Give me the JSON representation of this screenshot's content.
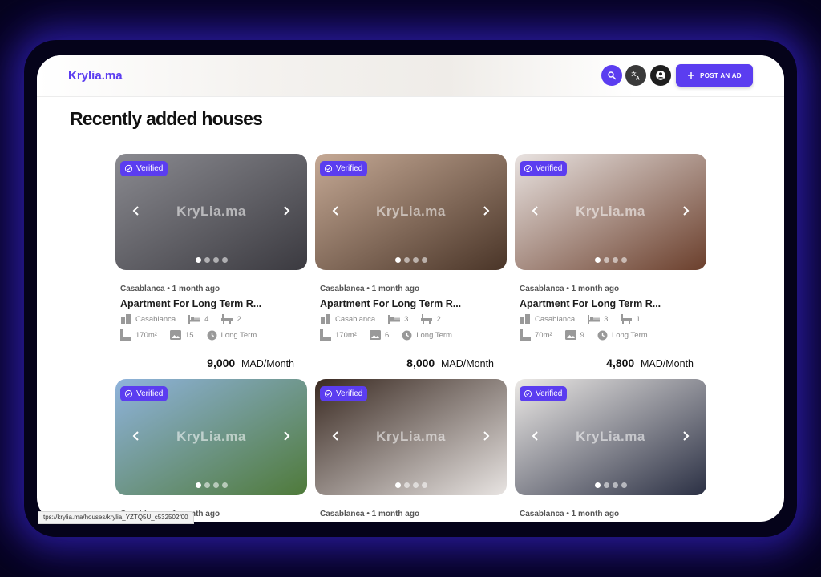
{
  "header": {
    "logo": "Krylia.ma",
    "post_ad_label": "POST AN AD"
  },
  "section_title": "Recently added houses",
  "status_url": "https://krylia.ma/houses/krylia_YZTQ5U_c532502f00",
  "status_url_visible": "tps://krylia.ma/houses/krylia_YZTQ5U_c532502f00",
  "icons": {
    "search": "search-icon",
    "translate": "translate-icon",
    "account": "account-icon",
    "plus": "plus-icon",
    "verified": "check-circle-icon",
    "city": "building-icon",
    "bed": "bed-icon",
    "bath": "bath-icon",
    "area": "ruler-icon",
    "photos": "image-icon",
    "term": "clock-icon"
  },
  "colors": {
    "accent": "#5b3df0",
    "background": "#05031a"
  },
  "listings": [
    {
      "verified": "Verified",
      "watermark": "KryLia.ma",
      "meta": "Casablanca • 1 month ago",
      "title": "Apartment For Long Term R...",
      "city": "Casablanca",
      "beds": "4",
      "baths": "2",
      "area": "170m²",
      "photos": "15",
      "term": "Long Term",
      "price": "9,000",
      "unit": "MAD/Month",
      "image_colors": [
        "#8a8a90",
        "#3b3a40"
      ]
    },
    {
      "verified": "Verified",
      "watermark": "KryLia.ma",
      "meta": "Casablanca • 1 month ago",
      "title": "Apartment For Long Term R...",
      "city": "Casablanca",
      "beds": "3",
      "baths": "2",
      "area": "170m²",
      "photos": "6",
      "term": "Long Term",
      "price": "8,000",
      "unit": "MAD/Month",
      "image_colors": [
        "#c5a995",
        "#4a3528"
      ]
    },
    {
      "verified": "Verified",
      "watermark": "KryLia.ma",
      "meta": "Casablanca • 1 month ago",
      "title": "Apartment For Long Term R...",
      "city": "Casablanca",
      "beds": "3",
      "baths": "1",
      "area": "70m²",
      "photos": "9",
      "term": "Long Term",
      "price": "4,800",
      "unit": "MAD/Month",
      "image_colors": [
        "#e9e3e1",
        "#6b3f2c"
      ]
    },
    {
      "verified": "Verified",
      "watermark": "KryLia.ma",
      "meta": "Casablanca • 1 month ago",
      "title": "",
      "price": "",
      "unit": "",
      "image_colors": [
        "#8fb3dc",
        "#4f7a3a"
      ]
    },
    {
      "verified": "Verified",
      "watermark": "KryLia.ma",
      "meta": "Casablanca • 1 month ago",
      "title": "",
      "price": "",
      "unit": "",
      "image_colors": [
        "#3a2a22",
        "#e8e4e2"
      ]
    },
    {
      "verified": "Verified",
      "watermark": "KryLia.ma",
      "meta": "Casablanca • 1 month ago",
      "title": "",
      "price": "",
      "unit": "",
      "image_colors": [
        "#ece9e6",
        "#2b3044"
      ]
    }
  ]
}
